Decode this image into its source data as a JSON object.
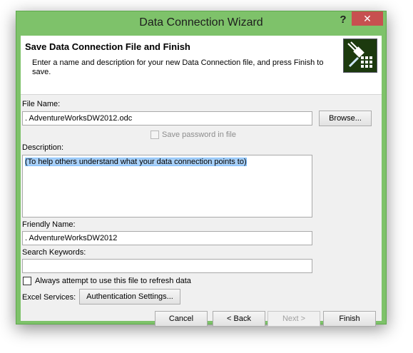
{
  "window": {
    "title": "Data Connection Wizard",
    "help_label": "?",
    "close_label": "✕"
  },
  "header": {
    "title": "Save Data Connection File and Finish",
    "description": "Enter a name and description for your new Data Connection file, and press Finish to save."
  },
  "file_name": {
    "label": "File Name:",
    "value": ". AdventureWorksDW2012.odc",
    "browse_label": "Browse..."
  },
  "save_password": {
    "label": "Save password in file",
    "checked": false,
    "enabled": false
  },
  "description": {
    "label": "Description:",
    "value": "(To help others understand what your data connection points to)"
  },
  "friendly_name": {
    "label": "Friendly Name:",
    "value": ". AdventureWorksDW2012"
  },
  "search_keywords": {
    "label": "Search Keywords:",
    "value": ""
  },
  "always_attempt": {
    "label": "Always attempt to use this file to refresh data",
    "checked": false
  },
  "excel_services": {
    "label": "Excel Services:",
    "auth_button": "Authentication Settings..."
  },
  "footer": {
    "cancel": "Cancel",
    "back": "< Back",
    "next": "Next >",
    "finish": "Finish"
  },
  "icons": {
    "wizard_icon": "data-connection-plug-icon"
  }
}
